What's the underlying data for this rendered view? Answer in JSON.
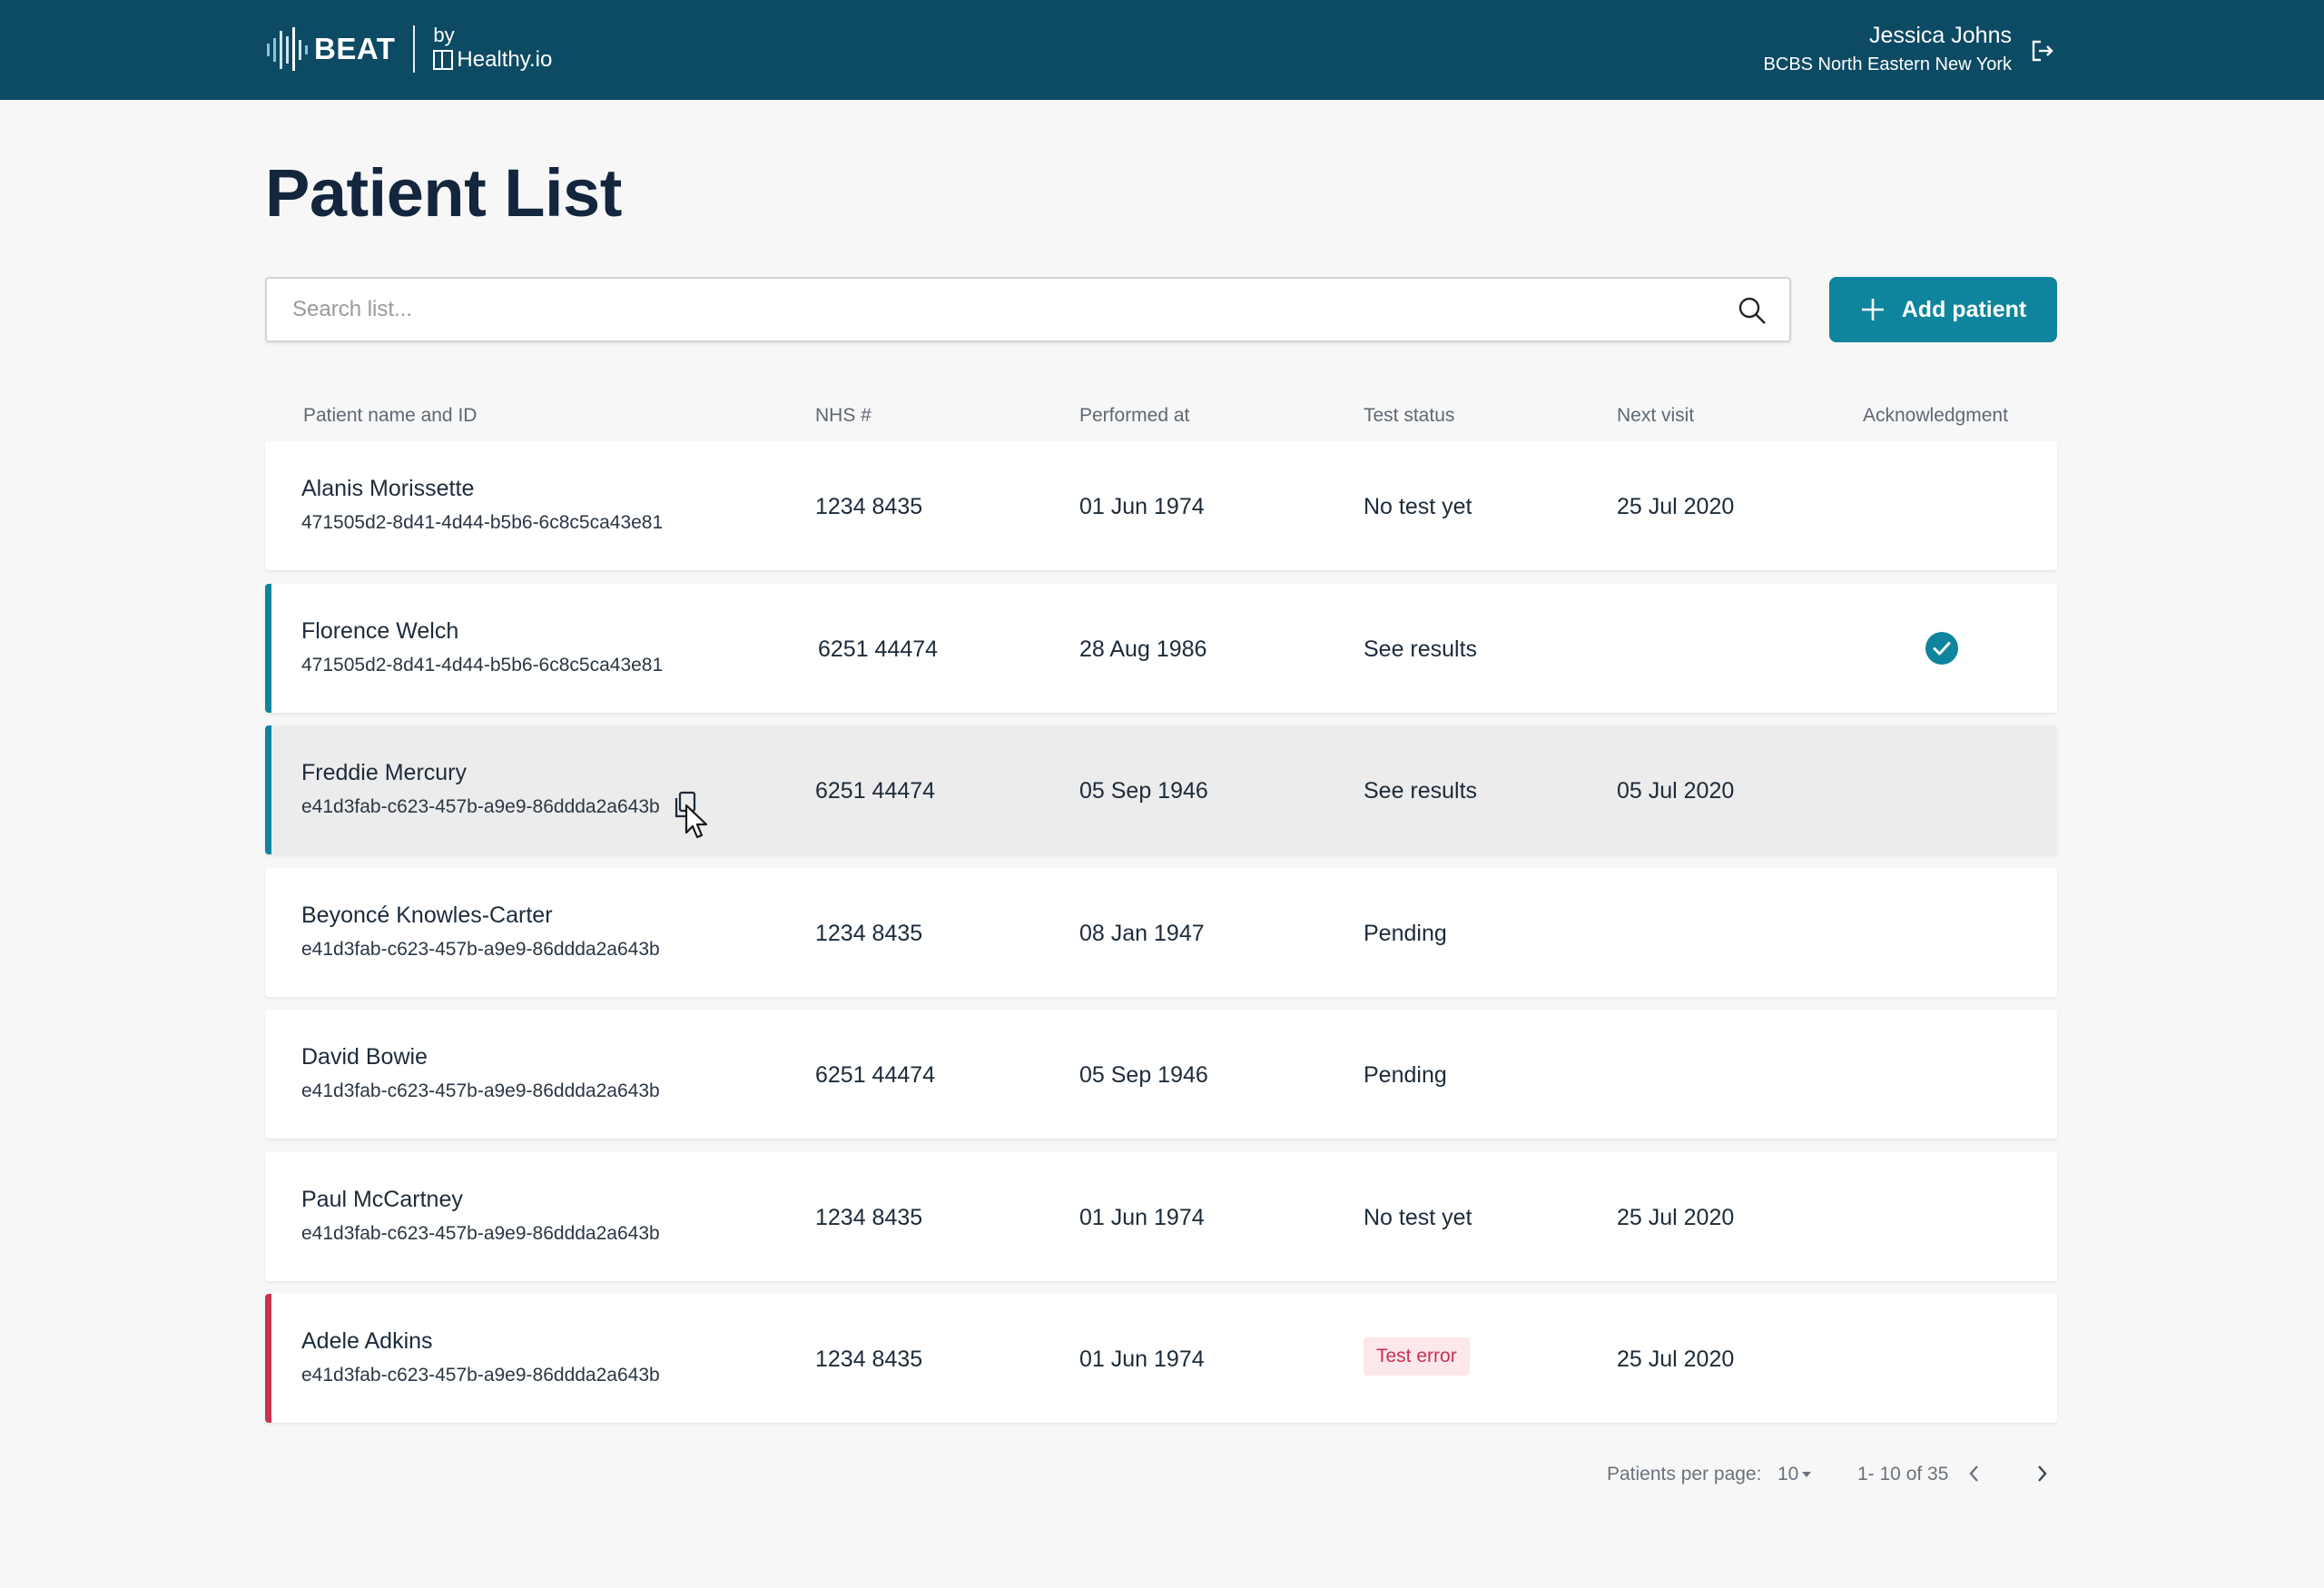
{
  "header": {
    "brand": "BEAT",
    "by": "by",
    "partner": "Healthy.io",
    "user_name": "Jessica Johns",
    "user_org": "BCBS North Eastern New York"
  },
  "page": {
    "title": "Patient List"
  },
  "search": {
    "placeholder": "Search list..."
  },
  "actions": {
    "add_patient": "Add patient"
  },
  "table": {
    "columns": {
      "name": "Patient name and ID",
      "nhs": "NHS #",
      "performed": "Performed at",
      "status": "Test status",
      "next": "Next visit",
      "ack": "Acknowledgment"
    },
    "rows": [
      {
        "name": "Alanis Morissette",
        "id": "471505d2-8d41-4d44-b5b6-6c8c5ca43e81",
        "nhs": "1234 8435",
        "performed": "01 Jun 1974",
        "status": "No test yet",
        "next": "25 Jul 2020",
        "accent": "",
        "acknowledged": false
      },
      {
        "name": "Florence Welch",
        "id": "471505d2-8d41-4d44-b5b6-6c8c5ca43e81",
        "nhs": "6251 44474",
        "performed": "28 Aug 1986",
        "status": "See results",
        "next": "",
        "accent": "#0f849d",
        "acknowledged": true
      },
      {
        "name": "Freddie Mercury",
        "id": "e41d3fab-c623-457b-a9e9-86ddda2a643b",
        "nhs": "6251 44474",
        "performed": "05 Sep 1946",
        "status": "See results",
        "next": "05 Jul 2020",
        "accent": "#0f849d",
        "acknowledged": false
      },
      {
        "name": "Beyoncé Knowles-Carter",
        "id": "e41d3fab-c623-457b-a9e9-86ddda2a643b",
        "nhs": "1234 8435",
        "performed": "08 Jan 1947",
        "status": "Pending",
        "next": "",
        "accent": "",
        "acknowledged": false
      },
      {
        "name": "David Bowie",
        "id": "e41d3fab-c623-457b-a9e9-86ddda2a643b",
        "nhs": "6251 44474",
        "performed": "05 Sep 1946",
        "status": "Pending",
        "next": "",
        "accent": "",
        "acknowledged": false
      },
      {
        "name": "Paul McCartney",
        "id": "e41d3fab-c623-457b-a9e9-86ddda2a643b",
        "nhs": "1234 8435",
        "performed": "01 Jun 1974",
        "status": "No test yet",
        "next": "25 Jul 2020",
        "accent": "",
        "acknowledged": false
      },
      {
        "name": "Adele Adkins",
        "id": "e41d3fab-c623-457b-a9e9-86ddda2a643b",
        "nhs": "1234 8435",
        "performed": "01 Jun 1974",
        "status": "Test error",
        "next": "25 Jul 2020",
        "accent": "#c6324f",
        "acknowledged": false
      }
    ]
  },
  "pagination": {
    "per_page_label": "Patients per page:",
    "per_page_value": "10",
    "range": "1- 10 of 35"
  },
  "colors": {
    "header_bg": "#0d4a63",
    "primary": "#0f849d",
    "error": "#c6324f"
  }
}
